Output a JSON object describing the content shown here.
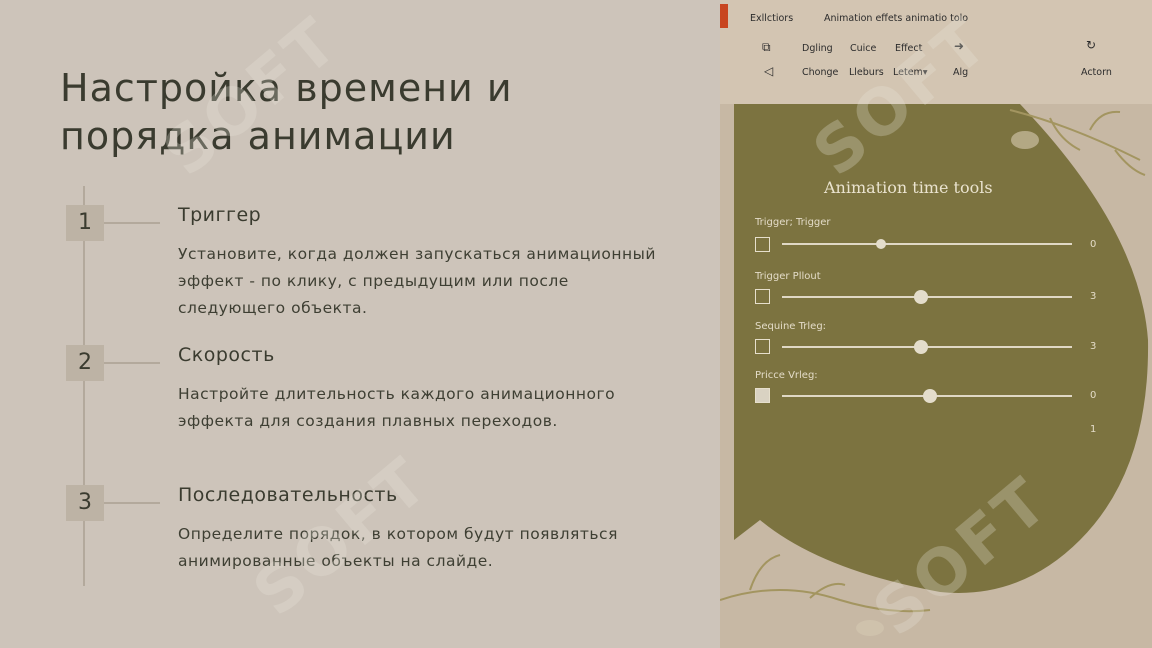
{
  "slide": {
    "title": "Настройка времени и порядка анимации",
    "steps": [
      {
        "number": "1",
        "title": "Триггер",
        "description": "Установите, когда должен запускаться анимационный эффект - по клику, с предыдущим или после следующего объекта."
      },
      {
        "number": "2",
        "title": "Скорость",
        "description": "Настройте длительность каждого анимационного эффекта для создания плавных переходов."
      },
      {
        "number": "3",
        "title": "Последовательность",
        "description": "Определите порядок, в котором будут появляться анимированные объекты на слайде."
      }
    ]
  },
  "ribbon": {
    "tab_label": "Exllctiors",
    "window_title": "Animation effets animatio tolo",
    "row1": [
      "Dgling",
      "Cuice",
      "Effect"
    ],
    "row2": [
      "Chonge",
      "Lleburs",
      "Letem▾",
      "Alg"
    ],
    "action_label": "Actorn",
    "icons": {
      "copy": "copy-icon",
      "back": "back-icon",
      "arrow": "arrow-right-icon",
      "rotate": "rotate-icon"
    }
  },
  "panel": {
    "title": "Animation time tools",
    "rows": [
      {
        "label": "Trigger; Trigger",
        "value": "0",
        "slider": 0.34,
        "checked": false
      },
      {
        "label": "Trigger Pllout",
        "value": "3",
        "slider": 0.48,
        "checked": false
      },
      {
        "label": "Sequine Trleg:",
        "value": "3",
        "slider": 0.48,
        "checked": false
      },
      {
        "label": "Pricce Vrleg:",
        "value": "0",
        "slider": 0.51,
        "checked": true
      }
    ],
    "footer_value": "1"
  },
  "watermark": "SOFT",
  "colors": {
    "olive": "#7c7340",
    "background": "#cdc4ba",
    "accent": "#c8451f"
  }
}
